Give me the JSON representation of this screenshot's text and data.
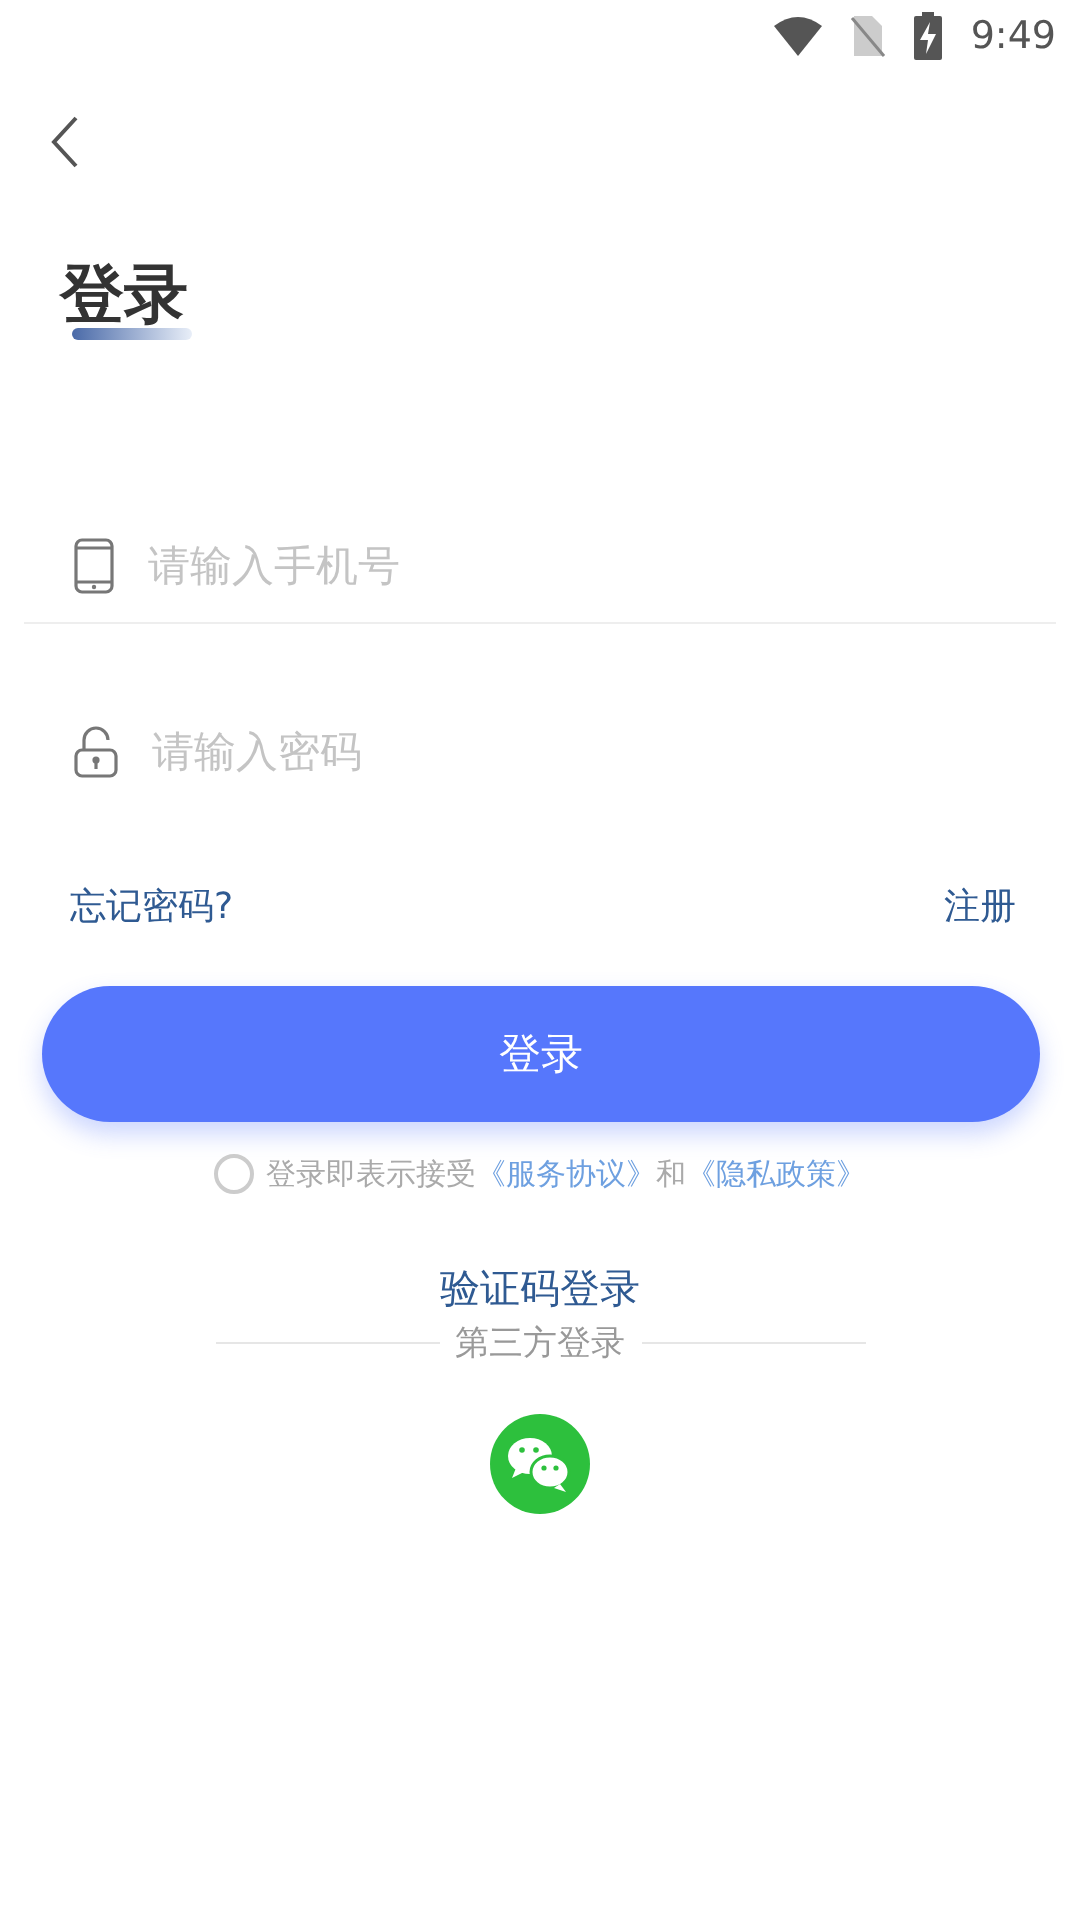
{
  "status_bar": {
    "time": "9:49"
  },
  "title": "登录",
  "fields": [
    {
      "kind": "phone",
      "placeholder": "请输入手机号",
      "underline": true
    },
    {
      "kind": "password",
      "placeholder": "请输入密码",
      "underline": false
    }
  ],
  "forgot_password": "忘记密码?",
  "register": "注册",
  "login_button": "登录",
  "agreement": {
    "checked": false,
    "text_before": "登录即表示接受",
    "link_1": "《服务协议》",
    "text_middle": "和",
    "link_2": "《隐私政策》"
  },
  "code_login": "验证码登录",
  "third_party": {
    "label": "第三方登录",
    "providers": [
      {
        "kind": "wechat"
      }
    ]
  }
}
